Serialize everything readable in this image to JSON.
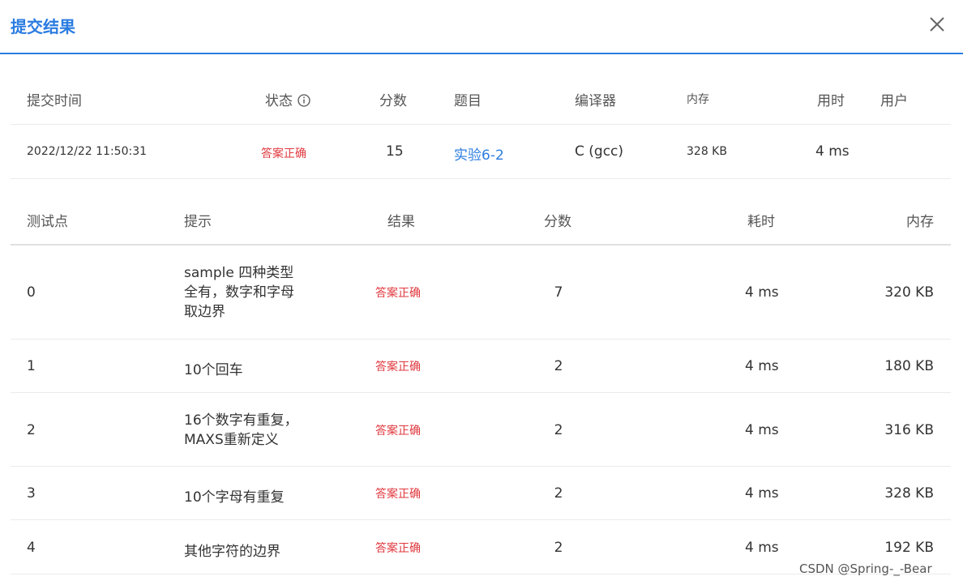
{
  "dialog": {
    "title": "提交结果"
  },
  "summary": {
    "headers": {
      "time": "提交时间",
      "status": "状态",
      "score": "分数",
      "problem": "题目",
      "compiler": "编译器",
      "memory": "内存",
      "duration": "用时",
      "user": "用户"
    },
    "row": {
      "time": "2022/12/22 11:50:31",
      "status": "答案正确",
      "score": "15",
      "problem": "实验6-2",
      "compiler": "C (gcc)",
      "memory": "328 KB",
      "duration": "4 ms",
      "user": ""
    }
  },
  "tests": {
    "headers": {
      "id": "测试点",
      "hint": "提示",
      "result": "结果",
      "score": "分数",
      "time": "耗时",
      "memory": "内存"
    },
    "rows": [
      {
        "id": "0",
        "hint": [
          "sample 四种类型",
          "全有，数字和字母",
          "取边界"
        ],
        "result": "答案正确",
        "score": "7",
        "time": "4 ms",
        "memory": "320 KB"
      },
      {
        "id": "1",
        "hint": [
          "10个回车"
        ],
        "result": "答案正确",
        "score": "2",
        "time": "4 ms",
        "memory": "180 KB"
      },
      {
        "id": "2",
        "hint": [
          "16个数字有重复，",
          "MAXS重新定义"
        ],
        "result": "答案正确",
        "score": "2",
        "time": "4 ms",
        "memory": "316 KB"
      },
      {
        "id": "3",
        "hint": [
          "10个字母有重复"
        ],
        "result": "答案正确",
        "score": "2",
        "time": "4 ms",
        "memory": "328 KB"
      },
      {
        "id": "4",
        "hint": [
          "其他字符的边界"
        ],
        "result": "答案正确",
        "score": "2",
        "time": "4 ms",
        "memory": "192 KB"
      }
    ]
  },
  "watermark": "CSDN @Spring-_-Bear",
  "colors": {
    "accent": "#2b7ce0",
    "success_text": "#e0383e"
  },
  "icons": {
    "close": "close-icon",
    "status_info": "info-circle-icon"
  }
}
